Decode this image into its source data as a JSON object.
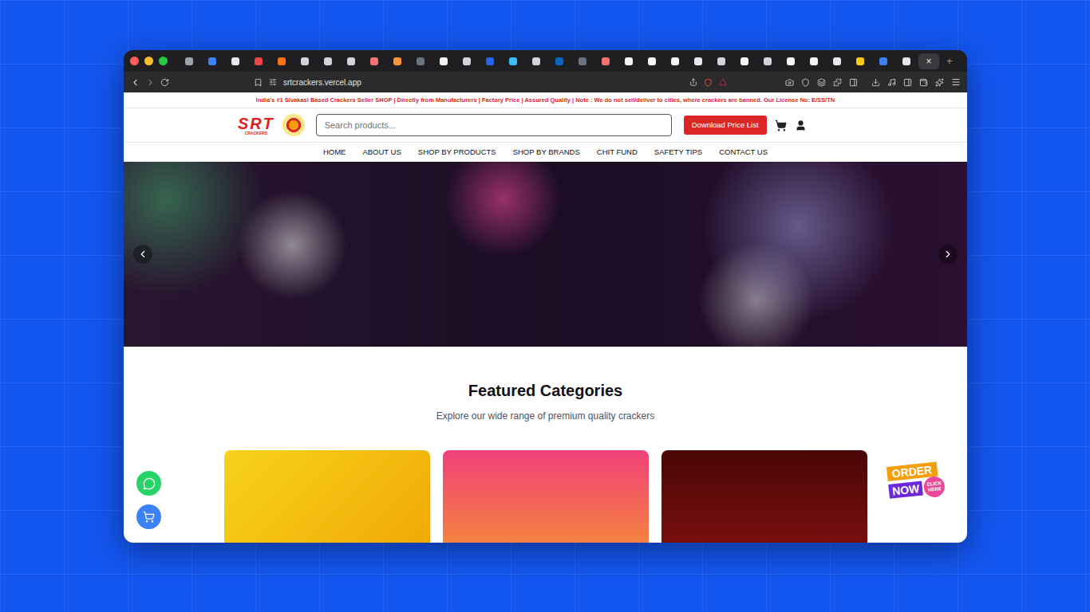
{
  "browser": {
    "tabs": [
      {
        "color": "#9ca3af",
        "selected": false
      },
      {
        "color": "#3b82f6",
        "selected": false
      },
      {
        "color": "#e5e7eb",
        "selected": false
      },
      {
        "color": "#ef4444",
        "selected": false
      },
      {
        "color": "#f97316",
        "selected": false
      },
      {
        "color": "#d1d5db",
        "selected": false
      },
      {
        "color": "#d1d5db",
        "selected": false
      },
      {
        "color": "#d1d5db",
        "selected": false
      },
      {
        "color": "#f87171",
        "selected": false
      },
      {
        "color": "#fb923c",
        "selected": false
      },
      {
        "color": "#6b7280",
        "selected": false
      },
      {
        "color": "#f3f4f6",
        "selected": false
      },
      {
        "color": "#d1d5db",
        "selected": false
      },
      {
        "color": "#2563eb",
        "selected": false
      },
      {
        "color": "#38bdf8",
        "selected": false
      },
      {
        "color": "#d1d5db",
        "selected": false
      },
      {
        "color": "#0a66c2",
        "selected": false
      },
      {
        "color": "#6b7280",
        "selected": false
      },
      {
        "color": "#f87171",
        "selected": false
      },
      {
        "color": "#f3f4f6",
        "selected": false
      },
      {
        "color": "#f3f4f6",
        "selected": false
      },
      {
        "color": "#f3f4f6",
        "selected": false
      },
      {
        "color": "#e5e7eb",
        "selected": false
      },
      {
        "color": "#d1d5db",
        "selected": false
      },
      {
        "color": "#f3f4f6",
        "selected": false
      },
      {
        "color": "#d1d5db",
        "selected": false
      },
      {
        "color": "#f3f4f6",
        "selected": false
      },
      {
        "color": "#f3f4f6",
        "selected": false
      },
      {
        "color": "#e5e7eb",
        "selected": false
      },
      {
        "color": "#facc15",
        "selected": false
      },
      {
        "color": "#3b82f6",
        "selected": false
      },
      {
        "color": "#e5e7eb",
        "selected": false
      },
      {
        "color": "#4b5563",
        "selected": true
      }
    ],
    "close_tab": "×",
    "new_tab": "+",
    "url": "srtcrackers.vercel.app"
  },
  "site": {
    "announcement": "India's #1 Sivakasi Based Crackers Seller SHOP | Directly from Manufacturers | Factory Price | Assured Quality | Note : We do not sell/deliver to cities, where crackers are banned. Our License No: E/SS/TN",
    "logo": {
      "name": "SRT",
      "sub": "CRACKERS"
    },
    "search": {
      "placeholder": "Search products..."
    },
    "download_button": "Download Price List",
    "nav": [
      "HOME",
      "ABOUT US",
      "SHOP BY PRODUCTS",
      "SHOP BY BRANDS",
      "CHIT FUND",
      "SAFETY TIPS",
      "CONTACT US"
    ],
    "featured": {
      "title": "Featured Categories",
      "subtitle": "Explore our wide range of premium quality crackers",
      "cards": [
        {
          "color": "#f5c518"
        },
        {
          "color": "#f0566e"
        },
        {
          "color": "#8b1212"
        }
      ]
    },
    "order_badge": {
      "line1": "ORDER",
      "line2": "NOW",
      "tag": "CLICK HERE"
    }
  }
}
